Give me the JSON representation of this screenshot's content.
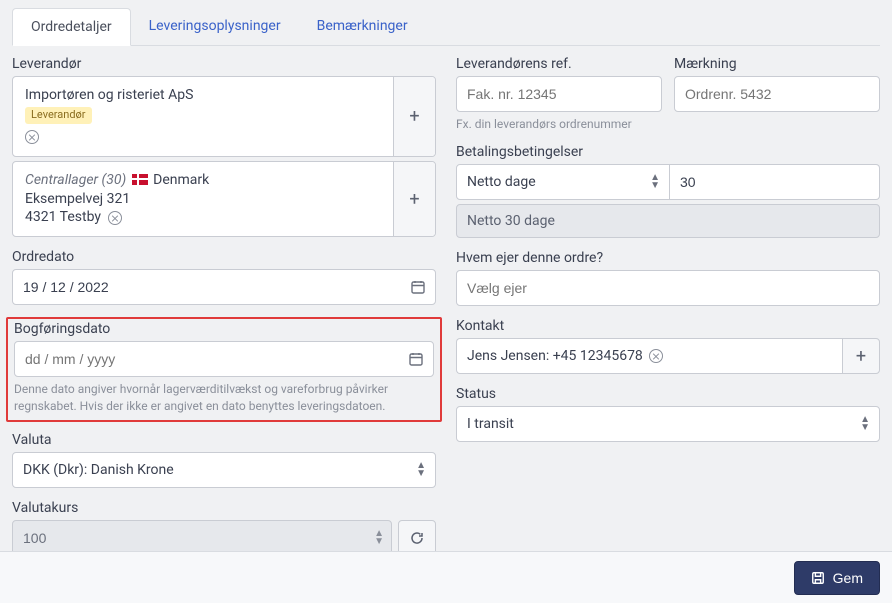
{
  "tabs": {
    "t0": "Ordredetaljer",
    "t1": "Leveringsoplysninger",
    "t2": "Bemærkninger",
    "activeIndex": 0
  },
  "supplier": {
    "label": "Leverandør",
    "name": "Importøren og risteriet ApS",
    "badge": "Leverandør",
    "location_name": "Centrallager (30)",
    "location_country": "Denmark",
    "addr1": "Eksempelvej 321",
    "addr2": "4321 Testby"
  },
  "order_date": {
    "label": "Ordredato",
    "value": "19 / 12 / 2022"
  },
  "posting_date": {
    "label": "Bogføringsdato",
    "placeholder": "dd / mm / yyyy",
    "help": "Denne dato angiver hvornår lagerværditilvækst og vareforbrug påvirker regnskabet. Hvis der ikke er angivet en dato benyttes leveringsdatoen."
  },
  "currency": {
    "label": "Valuta",
    "value": "DKK (Dkr): Danish Krone"
  },
  "exchange_rate": {
    "label": "Valutakurs",
    "value": "100"
  },
  "vendor_ref": {
    "label": "Leverandørens ref.",
    "placeholder": "Fak. nr. 12345",
    "help": "Fx. din leverandørs ordrenummer"
  },
  "marking": {
    "label": "Mærkning",
    "placeholder": "Ordrenr. 5432"
  },
  "payment_terms": {
    "label": "Betalingsbetingelser",
    "type": "Netto dage",
    "days": "30",
    "summary": "Netto 30 dage"
  },
  "owner": {
    "label": "Hvem ejer denne ordre?",
    "placeholder": "Vælg ejer"
  },
  "contact": {
    "label": "Kontakt",
    "value": "Jens Jensen: +45 12345678"
  },
  "status": {
    "label": "Status",
    "value": "I transit"
  },
  "footer": {
    "save": "Gem"
  }
}
